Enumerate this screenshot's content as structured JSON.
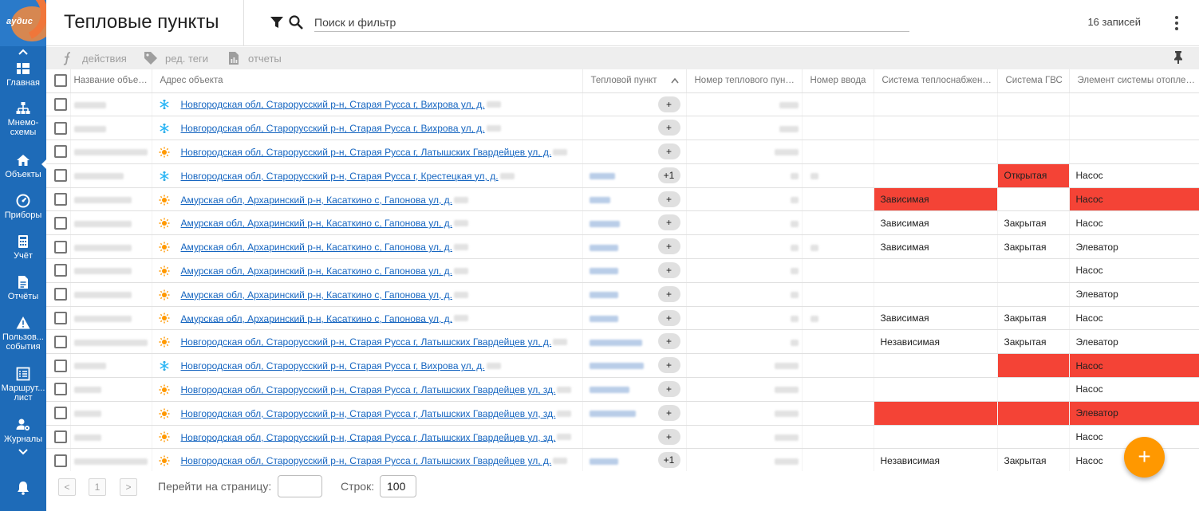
{
  "app": {
    "logo_text": "аудис",
    "accent_color": "#1e6bb8",
    "fab_color": "#ff9800",
    "alert_color": "#f44336"
  },
  "sidebar": {
    "items": [
      {
        "key": "home",
        "label": "Главная",
        "icon": "dashboard-icon"
      },
      {
        "key": "mnemo",
        "label": "Мнемо-схемы",
        "icon": "sitemap-icon"
      },
      {
        "key": "objects",
        "label": "Объекты",
        "icon": "home-icon",
        "active": true
      },
      {
        "key": "devices",
        "label": "Приборы",
        "icon": "gauge-icon"
      },
      {
        "key": "accounting",
        "label": "Учёт",
        "icon": "calculator-icon"
      },
      {
        "key": "reports",
        "label": "Отчёты",
        "icon": "document-icon"
      },
      {
        "key": "user_events",
        "label": "Пользов... события",
        "icon": "warning-icon"
      },
      {
        "key": "route",
        "label": "Маршрут... лист",
        "icon": "list-icon"
      },
      {
        "key": "journals",
        "label": "Журналы",
        "icon": "user-settings-icon"
      }
    ]
  },
  "header": {
    "title": "Тепловые пункты",
    "search_placeholder": "Поиск и фильтр",
    "records": "16 записей"
  },
  "toolbar": {
    "actions": "действия",
    "edit_tags": "ред. теги",
    "reports": "отчеты"
  },
  "table": {
    "columns": [
      "Название объекта",
      "Адрес объекта",
      "Тепловой пункт",
      "Номер теплового пункта",
      "Номер ввода",
      "Система теплоснабжения...",
      "Система ГВС",
      "Элемент системы отопления"
    ],
    "rows": [
      {
        "icon": "snowflake",
        "address": "Новгородская обл, Старорусский р-н, Старая Русса г, Вихрова ул, д.",
        "chip": "+",
        "heat_system": "",
        "gvs": "",
        "element": ""
      },
      {
        "icon": "snowflake",
        "address": "Новгородская обл, Старорусский р-н, Старая Русса г, Вихрова ул, д.",
        "chip": "+",
        "heat_system": "",
        "gvs": "",
        "element": ""
      },
      {
        "icon": "sun",
        "address": "Новгородская обл, Старорусский р-н, Старая Русса г, Латышских Гвардейцев ул, д.",
        "chip": "+",
        "heat_system": "",
        "gvs": "",
        "element": ""
      },
      {
        "icon": "snowflake",
        "address": "Новгородская обл, Старорусский р-н, Старая Русса г, Крестецкая ул, д.",
        "chip": "+1",
        "heat_system": "",
        "gvs": "Открытая",
        "element": "Насос"
      },
      {
        "icon": "sun",
        "address": "Амурская обл, Архаринский р-н, Касаткино с, Гапонова ул, д.",
        "chip": "+",
        "heat_system": "Зависимая",
        "gvs": "",
        "element": "Насос"
      },
      {
        "icon": "sun",
        "address": "Амурская обл, Архаринский р-н, Касаткино с, Гапонова ул, д.",
        "chip": "+",
        "heat_system": "Зависимая",
        "gvs": "Закрытая",
        "element": "Насос"
      },
      {
        "icon": "sun",
        "address": "Амурская обл, Архаринский р-н, Касаткино с, Гапонова ул, д.",
        "chip": "+",
        "heat_system": "Зависимая",
        "gvs": "Закрытая",
        "element": "Элеватор"
      },
      {
        "icon": "sun",
        "address": "Амурская обл, Архаринский р-н, Касаткино с, Гапонова ул, д.",
        "chip": "+",
        "heat_system": "",
        "gvs": "",
        "element": "Насос"
      },
      {
        "icon": "sun",
        "address": "Амурская обл, Архаринский р-н, Касаткино с, Гапонова ул, д.",
        "chip": "+",
        "heat_system": "",
        "gvs": "",
        "element": "Элеватор"
      },
      {
        "icon": "sun",
        "address": "Амурская обл, Архаринский р-н, Касаткино с, Гапонова ул, д.",
        "chip": "+",
        "heat_system": "Зависимая",
        "gvs": "Закрытая",
        "element": "Насос"
      },
      {
        "icon": "sun",
        "address": "Новгородская обл, Старорусский р-н, Старая Русса г, Латышских Гвардейцев ул, д.",
        "chip": "+",
        "heat_system": "Независимая",
        "gvs": "Закрытая",
        "element": "Элеватор"
      },
      {
        "icon": "snowflake",
        "address": "Новгородская обл, Старорусский р-н, Старая Русса г, Вихрова ул, д.",
        "chip": "+",
        "heat_system": "",
        "gvs": "",
        "element": "Насос"
      },
      {
        "icon": "sun",
        "address": "Новгородская обл, Старорусский р-н, Старая Русса г, Латышских Гвардейцев ул, зд.",
        "chip": "+",
        "heat_system": "",
        "gvs": "",
        "element": "Насос"
      },
      {
        "icon": "sun",
        "address": "Новгородская обл, Старорусский р-н, Старая Русса г, Латышских Гвардейцев ул, зд.",
        "chip": "+",
        "heat_system": "",
        "gvs": "",
        "element": "Элеватор"
      },
      {
        "icon": "sun",
        "address": "Новгородская обл, Старорусский р-н, Старая Русса г, Латышских Гвардейцев ул, зд.",
        "chip": "+",
        "heat_system": "",
        "gvs": "",
        "element": "Насос"
      },
      {
        "icon": "sun",
        "address": "Новгородская обл, Старорусский р-н, Старая Русса г, Латышских Гвардейцев ул, д.",
        "chip": "+1",
        "heat_system": "Независимая",
        "gvs": "Закрытая",
        "element": "Насос"
      }
    ]
  },
  "pagination": {
    "prev": "<",
    "page": "1",
    "next": ">",
    "goto_label": "Перейти на страницу:",
    "goto_value": "",
    "rows_label": "Строк:",
    "rows_value": "100"
  },
  "fab": {
    "label": "+"
  }
}
